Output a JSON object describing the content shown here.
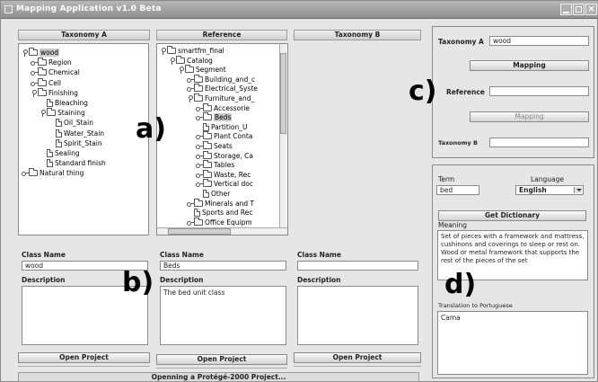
{
  "window": {
    "title": "Mapping Application v1.0 Beta"
  },
  "columns": {
    "taxonomy_a": "Taxonomy A",
    "reference": "Reference",
    "taxonomy_b": "Taxonomy B"
  },
  "tree_a": [
    {
      "label": "wood",
      "icon": "folder-icon",
      "knob": "open",
      "selected": true
    },
    {
      "label": "Region",
      "icon": "folder-icon",
      "knob": "closed"
    },
    {
      "label": "Chemical",
      "icon": "folder-icon",
      "knob": "closed"
    },
    {
      "label": "Cell",
      "icon": "folder-icon",
      "knob": "closed"
    },
    {
      "label": "Finishing",
      "icon": "folder-icon",
      "knob": "open"
    },
    {
      "label": "Bleaching",
      "icon": "document-icon",
      "knob": "none"
    },
    {
      "label": "Staining",
      "icon": "folder-icon",
      "knob": "open"
    },
    {
      "label": "Oil_Stain",
      "icon": "document-icon",
      "knob": "none"
    },
    {
      "label": "Water_Stain",
      "icon": "document-icon",
      "knob": "none"
    },
    {
      "label": "Spirit_Stain",
      "icon": "document-icon",
      "knob": "none"
    },
    {
      "label": "Sealing",
      "icon": "document-icon",
      "knob": "none"
    },
    {
      "label": "Standard finish",
      "icon": "document-icon",
      "knob": "none"
    },
    {
      "label": "Natural thing",
      "icon": "folder-icon",
      "knob": "closed"
    }
  ],
  "tree_ref": [
    {
      "label": "smartfm_final",
      "icon": "folder-icon",
      "knob": "open"
    },
    {
      "label": "Catalog",
      "icon": "folder-icon",
      "knob": "open"
    },
    {
      "label": "Segment",
      "icon": "folder-icon",
      "knob": "open"
    },
    {
      "label": "Building_and_c",
      "icon": "folder-icon",
      "knob": "closed"
    },
    {
      "label": "Electrical_Syste",
      "icon": "folder-icon",
      "knob": "closed"
    },
    {
      "label": "Furniture_and_",
      "icon": "folder-icon",
      "knob": "open"
    },
    {
      "label": "Accessorie",
      "icon": "folder-icon",
      "knob": "closed"
    },
    {
      "label": "Beds",
      "icon": "folder-icon",
      "knob": "closed",
      "selected": true
    },
    {
      "label": "Partition_U",
      "icon": "document-icon",
      "knob": "none"
    },
    {
      "label": "Plant Conta",
      "icon": "folder-icon",
      "knob": "closed"
    },
    {
      "label": "Seats",
      "icon": "folder-icon",
      "knob": "closed"
    },
    {
      "label": "Storage, Ca",
      "icon": "folder-icon",
      "knob": "closed"
    },
    {
      "label": "Tables",
      "icon": "folder-icon",
      "knob": "closed"
    },
    {
      "label": "Waste, Rec",
      "icon": "folder-icon",
      "knob": "closed"
    },
    {
      "label": "Vertical doc",
      "icon": "folder-icon",
      "knob": "closed"
    },
    {
      "label": "Other",
      "icon": "document-icon",
      "knob": "none"
    },
    {
      "label": "Minerals and T",
      "icon": "folder-icon",
      "knob": "closed"
    },
    {
      "label": "Sports and Rec",
      "icon": "document-icon",
      "knob": "none"
    },
    {
      "label": "Office Equipm",
      "icon": "folder-icon",
      "knob": "closed"
    }
  ],
  "class_a": {
    "name_label": "Class Name",
    "name_value": "wood",
    "desc_label": "Description",
    "desc_value": ""
  },
  "class_ref": {
    "name_label": "Class Name",
    "name_value": "Beds",
    "desc_label": "Description",
    "desc_value": "The bed unit class"
  },
  "class_b": {
    "name_label": "Class Name",
    "name_value": "",
    "desc_label": "Description",
    "desc_value": ""
  },
  "buttons": {
    "open_project_a": "Open Project",
    "open_project_ref": "Open Project",
    "open_project_b": "Open Project"
  },
  "status": "Openning a Protégé-2000 Project...",
  "mapping_panel": {
    "taxonomy_a_label": "Taxonomy A",
    "taxonomy_a_value": "wood",
    "mapping_button": "Mapping",
    "reference_label": "Reference",
    "reference_value": "",
    "mapping_button_2": "Mapping",
    "taxonomy_b_label": "Taxonomy B",
    "taxonomy_b_value": ""
  },
  "dictionary_panel": {
    "term_label": "Term",
    "term_value": "bed",
    "language_label": "Language",
    "language_value": "English",
    "get_dictionary": "Get Dictionary",
    "meaning_label": "Meaning",
    "meaning_value": "Set of pieces with a framework and mattress, cushinons and coverings to sleep or rest on. Wood or metal framework that supports the rest of the pieces of the set",
    "translation_label": "Translation to Portuguese",
    "translation_value": "Cama"
  },
  "annotations": {
    "a": "a)",
    "b": "b)",
    "c": "c)",
    "d": "d)"
  }
}
